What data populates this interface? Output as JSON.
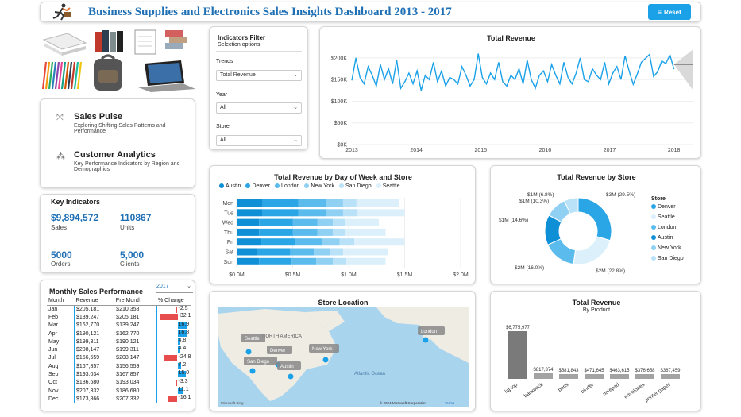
{
  "header": {
    "title": "Business Supplies and Electronics Sales Insights Dashboard 2013 - 2017",
    "reset_label": "Reset"
  },
  "filter": {
    "title": "Indicators Filter",
    "subtitle": "Selection options",
    "trends_label": "Trends",
    "trends_value": "Total Revenue",
    "year_label": "Year",
    "year_value": "All",
    "store_label": "Store",
    "store_value": "All"
  },
  "nav": {
    "sales_pulse_title": "Sales Pulse",
    "sales_pulse_desc": "Exploring Shifting Sales Patterns and Performance",
    "customer_title": "Customer Analytics",
    "customer_desc": "Key Performance Indicators by Region and Demographics"
  },
  "kpi": {
    "title": "Key Indicators",
    "sales_value": "$9,894,572",
    "sales_label": "Sales",
    "units_value": "110867",
    "units_label": "Units",
    "orders_value": "5000",
    "orders_label": "Orders",
    "clients_value": "5,000",
    "clients_label": "Clients"
  },
  "monthly": {
    "title": "Monthly Sales Performance",
    "year": "2017",
    "headers": [
      "Month",
      "Revenue",
      "Pre Month",
      "% Change"
    ],
    "rows": [
      {
        "month": "Jan",
        "revenue": "$205,181",
        "pre": "$210,358",
        "change": -2.5,
        "change_label": "-2.5"
      },
      {
        "month": "Feb",
        "revenue": "$139,247",
        "pre": "$205,181",
        "change": -32.1,
        "change_label": "-32.1"
      },
      {
        "month": "Mar",
        "revenue": "$162,770",
        "pre": "$139,247",
        "change": 16.9,
        "change_label": "16.9"
      },
      {
        "month": "Apr",
        "revenue": "$190,121",
        "pre": "$162,770",
        "change": 16.8,
        "change_label": "16.8"
      },
      {
        "month": "May",
        "revenue": "$199,311",
        "pre": "$190,121",
        "change": 4.8,
        "change_label": "4.8"
      },
      {
        "month": "Jun",
        "revenue": "$208,147",
        "pre": "$199,311",
        "change": 4.4,
        "change_label": "4.4"
      },
      {
        "month": "Jul",
        "revenue": "$156,559",
        "pre": "$208,147",
        "change": -24.8,
        "change_label": "-24.8"
      },
      {
        "month": "Aug",
        "revenue": "$167,857",
        "pre": "$156,559",
        "change": 7.2,
        "change_label": "7.2"
      },
      {
        "month": "Sep",
        "revenue": "$193,034",
        "pre": "$167,857",
        "change": 15.0,
        "change_label": "15.0"
      },
      {
        "month": "Oct",
        "revenue": "$186,680",
        "pre": "$193,034",
        "change": -3.3,
        "change_label": "-3.3"
      },
      {
        "month": "Nov",
        "revenue": "$207,332",
        "pre": "$186,680",
        "change": 11.1,
        "change_label": "11.1"
      },
      {
        "month": "Dec",
        "revenue": "$173,866",
        "pre": "$207,332",
        "change": -16.1,
        "change_label": "-16.1"
      }
    ]
  },
  "map": {
    "title": "Store Location",
    "labels": [
      "Seattle",
      "Denver",
      "New York",
      "San Diego",
      "Austin",
      "London"
    ],
    "continent_label": "NORTH AMERICA",
    "ocean_label": "Atlantic Ocean",
    "credit": "© 2024 Microsoft Corporation",
    "terms": "Terms",
    "bing": "Microsoft Bing"
  },
  "colors": {
    "accent": "#1aa1e8",
    "title": "#1f6fb5",
    "austin": "#0f8fd6",
    "denver": "#2aa6e6",
    "london": "#5cbbed",
    "newyork": "#8fd0f3",
    "sandiego": "#b9e1f7",
    "seattle": "#dcf0fb",
    "waterfall_pos": "#7a7a7a",
    "waterfall_neg": "#a3a3a3",
    "neg_bar": "#e84d4d",
    "pos_bar": "#1aa1e8"
  },
  "chart_data": [
    {
      "type": "line",
      "title": "Total Revenue",
      "x_ticks": [
        "2013",
        "2014",
        "2015",
        "2016",
        "2017",
        "2018"
      ],
      "y_ticks": [
        "$0K",
        "$50K",
        "$100K",
        "$150K",
        "$200K"
      ],
      "ylim": [
        0,
        220000
      ],
      "xlim": [
        2013,
        2018.3
      ],
      "series": [
        {
          "values": [
            148000,
            200000,
            155000,
            140000,
            180000,
            160000,
            135000,
            185000,
            150000,
            175000,
            140000,
            195000,
            130000,
            145000,
            165000,
            140000,
            170000,
            125000,
            160000,
            150000,
            190000,
            145000,
            170000,
            135000,
            155000,
            150000,
            140000,
            180000,
            160000,
            135000,
            150000,
            210000,
            155000,
            140000,
            165000,
            150000,
            190000,
            145000,
            135000,
            160000,
            150000,
            175000,
            140000,
            195000,
            150000,
            130000,
            160000,
            170000,
            145000,
            185000,
            160000,
            140000,
            190000,
            155000,
            140000,
            165000,
            200000,
            150000,
            145000,
            175000,
            160000,
            150000,
            190000,
            140000,
            165000,
            180000,
            150000,
            205000,
            170000,
            139000,
            163000,
            190000,
            199000,
            208000,
            157000,
            168000,
            193000,
            187000,
            207000,
            174000
          ]
        }
      ],
      "forecast": {
        "start": 2018.0,
        "end": 2018.3,
        "mid": 185000,
        "upper": [
          185000,
          220000
        ],
        "lower": [
          185000,
          125000
        ]
      }
    },
    {
      "type": "bar",
      "title": "Total Revenue by Day of Week and Store",
      "categories": [
        "Mon",
        "Tue",
        "Wed",
        "Thu",
        "Fri",
        "Sat",
        "Sun"
      ],
      "x_ticks": [
        "$0.0M",
        "$0.5M",
        "$1.0M",
        "$1.5M",
        "$2.0M"
      ],
      "xlim": [
        0,
        2000000
      ],
      "series": [
        {
          "name": "Austin",
          "values": [
            230000,
            230000,
            200000,
            200000,
            220000,
            190000,
            200000
          ]
        },
        {
          "name": "Denver",
          "values": [
            320000,
            320000,
            300000,
            300000,
            300000,
            290000,
            290000
          ]
        },
        {
          "name": "London",
          "values": [
            250000,
            250000,
            220000,
            220000,
            240000,
            210000,
            220000
          ]
        },
        {
          "name": "New York",
          "values": [
            150000,
            150000,
            140000,
            140000,
            160000,
            140000,
            150000
          ]
        },
        {
          "name": "San Diego",
          "values": [
            120000,
            130000,
            110000,
            110000,
            130000,
            120000,
            120000
          ]
        },
        {
          "name": "Seattle",
          "values": [
            380000,
            420000,
            300000,
            360000,
            450000,
            400000,
            350000
          ]
        }
      ]
    },
    {
      "type": "pie",
      "title": "Total Revenue by Store",
      "legend_title": "Store",
      "legend": [
        "Denver",
        "Seattle",
        "London",
        "Austin",
        "New York",
        "San Diego"
      ],
      "slices": [
        {
          "name": "Denver",
          "value": 3000000,
          "label": "$3M (29.5%)"
        },
        {
          "name": "Seattle",
          "value": 2000000,
          "label": "$2M (22.8%)"
        },
        {
          "name": "London",
          "value": 2000000,
          "label": "$2M (16.0%)"
        },
        {
          "name": "Austin",
          "value": 1000000,
          "label": "$1M (14.6%)"
        },
        {
          "name": "New York",
          "value": 1000000,
          "label": "$1M (10.3%)"
        },
        {
          "name": "San Diego",
          "value": 1000000,
          "label": "$1M (6.8%)"
        }
      ],
      "shares": [
        29.5,
        22.8,
        16.0,
        14.6,
        10.3,
        6.8
      ]
    },
    {
      "type": "bar",
      "title": "Total Revenue",
      "subtitle": "By Product",
      "categories": [
        "laptop",
        "backpack",
        "pens",
        "binder",
        "notepad",
        "envelopes",
        "printer paper"
      ],
      "values": [
        6775977,
        817374,
        581843,
        471645,
        463615,
        376658,
        367459
      ],
      "labels": [
        "$6,775,977",
        "$817,374",
        "$581,843",
        "$471,645",
        "$463,615",
        "$376,658",
        "$367,459"
      ]
    }
  ]
}
